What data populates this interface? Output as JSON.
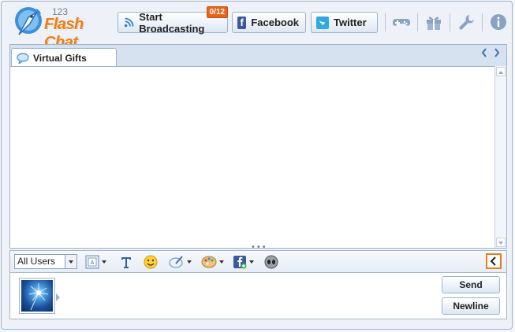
{
  "app": {
    "logo_number": "123",
    "logo_text": "Flash Chat"
  },
  "header": {
    "broadcast_label": "Start Broadcasting",
    "broadcast_badge": "0/12",
    "facebook_label": "Facebook",
    "twitter_label": "Twitter",
    "tool_icons": [
      "gamepad-icon",
      "gift-icon",
      "wrench-icon",
      "info-icon"
    ]
  },
  "chat": {
    "tabs": [
      {
        "label": "Virtual Gifts",
        "icon": "speech-bubble-icon"
      }
    ]
  },
  "toolbar": {
    "recipient_select": "All Users",
    "icons": [
      "font-color-icon",
      "text-format-icon",
      "emoticon-icon",
      "brush-icon",
      "palette-icon",
      "facebook-share-icon",
      "alien-icon"
    ]
  },
  "input": {
    "message_value": "",
    "send_label": "Send",
    "newline_label": "Newline"
  },
  "colors": {
    "accent_orange": "#f07d10",
    "facebook_blue": "#3b5998",
    "twitter_blue": "#33a8e0",
    "border_blue": "#9fb3cc"
  }
}
